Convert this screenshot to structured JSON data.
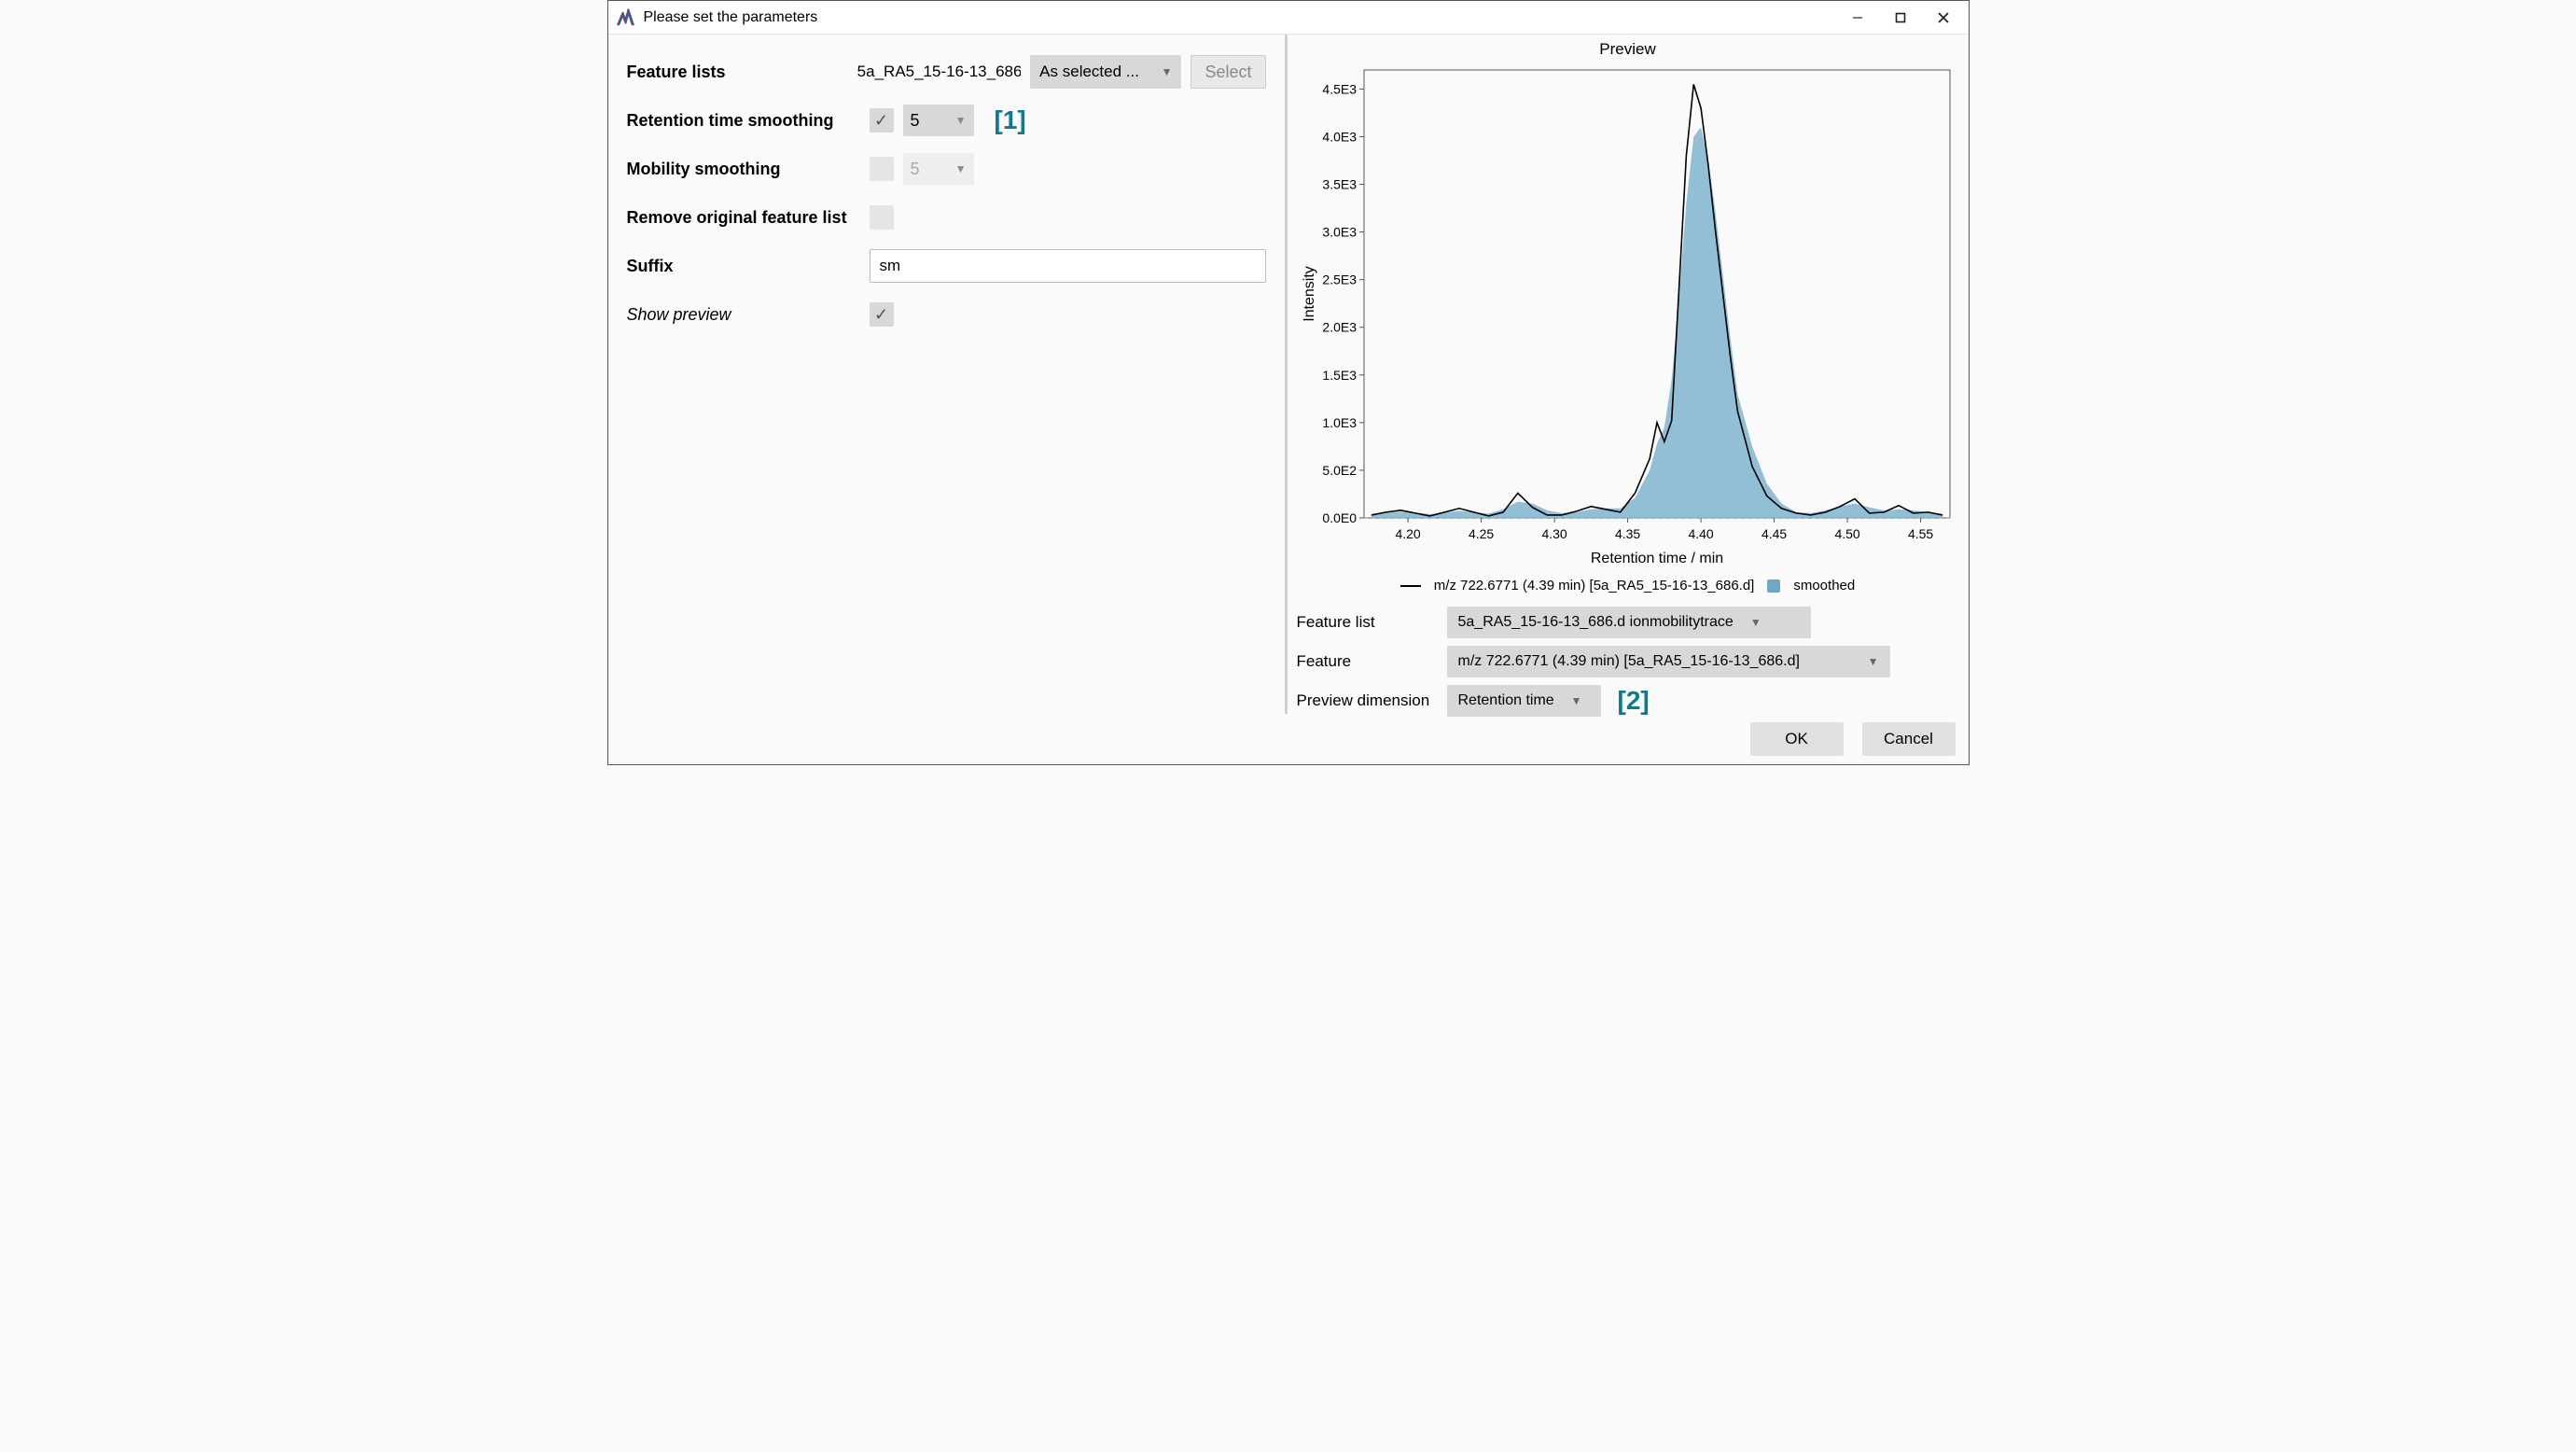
{
  "window": {
    "title": "Please set the parameters"
  },
  "left": {
    "feature_lists_label": "Feature lists",
    "feature_lists_value": "5a_RA5_15-16-13_686....",
    "feature_lists_mode": "As selected ...",
    "select_btn": "Select",
    "rt_smoothing_label": "Retention time smoothing",
    "rt_smoothing_checked": true,
    "rt_smoothing_value": "5",
    "mobility_label": "Mobility smoothing",
    "mobility_checked": false,
    "mobility_value": "5",
    "remove_label": "Remove original feature list",
    "remove_checked": false,
    "suffix_label": "Suffix",
    "suffix_value": "sm",
    "show_preview_label": "Show preview",
    "show_preview_checked": true,
    "annot1": "[1]"
  },
  "preview": {
    "title": "Preview",
    "ylabel": "Intensity",
    "xlabel": "Retention time / min",
    "legend_line": "m/z 722.6771 (4.39 min) [5a_RA5_15-16-13_686.d]",
    "legend_fill": "smoothed",
    "feature_list_label": "Feature list",
    "feature_list_value": "5a_RA5_15-16-13_686.d ionmobilitytrace",
    "feature_label": "Feature",
    "feature_value": "m/z 722.6771 (4.39 min) [5a_RA5_15-16-13_686.d]",
    "dimension_label": "Preview dimension",
    "dimension_value": "Retention time",
    "annot2": "[2]"
  },
  "footer": {
    "ok": "OK",
    "cancel": "Cancel"
  },
  "chart_data": {
    "type": "line",
    "title": "Preview",
    "xlabel": "Retention time / min",
    "ylabel": "Intensity",
    "xlim": [
      4.17,
      4.57
    ],
    "ylim": [
      0,
      4700
    ],
    "xticks": [
      4.2,
      4.25,
      4.3,
      4.35,
      4.4,
      4.45,
      4.5,
      4.55
    ],
    "yticks": [
      0,
      500,
      1000,
      1500,
      2000,
      2500,
      3000,
      3500,
      4000,
      4500
    ],
    "ytick_labels": [
      "0.0E0",
      "5.0E2",
      "1.0E3",
      "1.5E3",
      "2.0E3",
      "2.5E3",
      "3.0E3",
      "3.5E3",
      "4.0E3",
      "4.5E3"
    ],
    "x": [
      4.175,
      4.185,
      4.195,
      4.205,
      4.215,
      4.225,
      4.235,
      4.245,
      4.255,
      4.265,
      4.275,
      4.285,
      4.295,
      4.305,
      4.315,
      4.325,
      4.335,
      4.345,
      4.355,
      4.365,
      4.37,
      4.375,
      4.38,
      4.385,
      4.39,
      4.395,
      4.4,
      4.405,
      4.41,
      4.415,
      4.42,
      4.425,
      4.435,
      4.445,
      4.455,
      4.465,
      4.475,
      4.485,
      4.495,
      4.505,
      4.515,
      4.525,
      4.535,
      4.545,
      4.555,
      4.565
    ],
    "series": [
      {
        "name": "m/z 722.6771 (4.39 min) [5a_RA5_15-16-13_686.d]",
        "values": [
          30,
          60,
          80,
          50,
          20,
          60,
          100,
          60,
          20,
          60,
          260,
          110,
          30,
          30,
          70,
          120,
          90,
          60,
          260,
          620,
          1000,
          800,
          1020,
          2400,
          3800,
          4550,
          4300,
          3700,
          3000,
          2350,
          1700,
          1120,
          540,
          230,
          100,
          50,
          30,
          60,
          120,
          200,
          50,
          60,
          130,
          50,
          60,
          30
        ]
      },
      {
        "name": "smoothed",
        "values": [
          30,
          55,
          65,
          55,
          40,
          55,
          75,
          60,
          45,
          90,
          170,
          150,
          80,
          50,
          60,
          90,
          100,
          100,
          210,
          500,
          780,
          950,
          1450,
          2300,
          3300,
          4000,
          4100,
          3750,
          3200,
          2550,
          1900,
          1300,
          750,
          360,
          150,
          60,
          50,
          80,
          120,
          150,
          110,
          80,
          90,
          80,
          60,
          30
        ]
      }
    ]
  }
}
